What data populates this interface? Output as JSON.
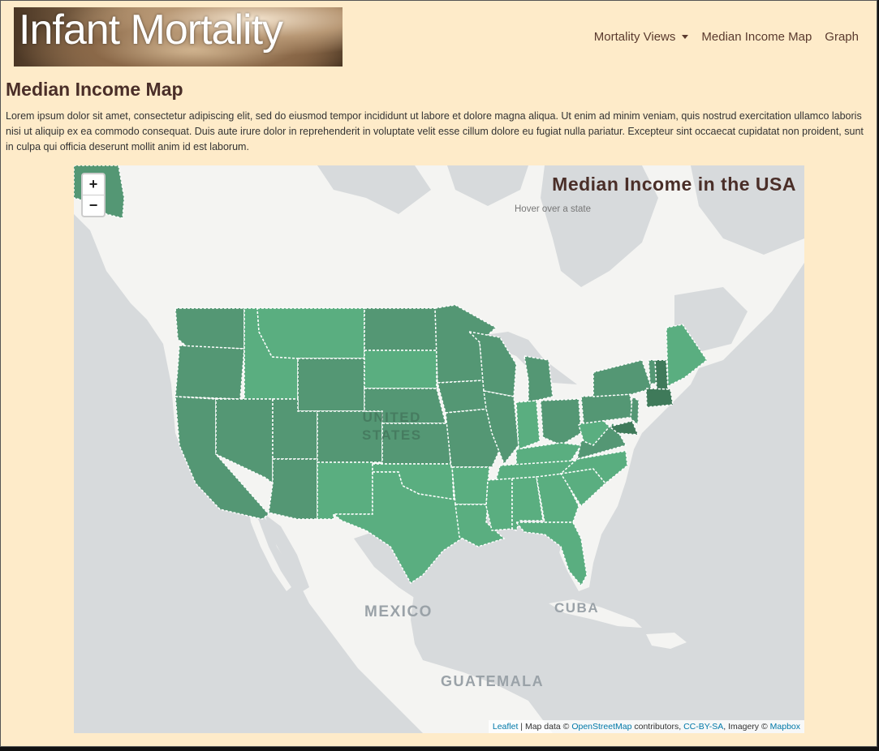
{
  "brand": {
    "title": "Infant Mortality"
  },
  "nav": {
    "items": [
      {
        "label": "Mortality Views",
        "dropdown": true
      },
      {
        "label": "Median Income Map",
        "dropdown": false
      },
      {
        "label": "Graph",
        "dropdown": false
      }
    ]
  },
  "page": {
    "heading": "Median Income Map",
    "body": "Lorem ipsum dolor sit amet, consectetur adipiscing elit, sed do eiusmod tempor incididunt ut labore et dolore magna aliqua. Ut enim ad minim veniam, quis nostrud exercitation ullamco laboris nisi ut aliquip ex ea commodo consequat. Duis aute irure dolor in reprehenderit in voluptate velit esse cillum dolore eu fugiat nulla pariatur. Excepteur sint occaecat cupidatat non proident, sunt in culpa qui officia deserunt mollit anim id est laborum."
  },
  "map": {
    "zoom_in": "+",
    "zoom_out": "−",
    "info_title": "Median Income in the USA",
    "info_hint": "Hover over a state",
    "labels": {
      "us_line1": "UNITED",
      "us_line2": "STATES",
      "mexico": "MEXICO",
      "cuba": "CUBA",
      "guatemala": "GUATEMALA"
    },
    "attribution": {
      "leaflet": "Leaflet",
      "sep1": " | Map data © ",
      "osm": "OpenStreetMap",
      "contributors": " contributors, ",
      "license": "CC-BY-SA",
      "imagery": ", Imagery © ",
      "mapbox": "Mapbox"
    },
    "colors": {
      "water": "#d7dadc",
      "land": "#f4f4f2",
      "light_green": "#5aae80",
      "dark_green": "#549774",
      "darkest_green": "#3f7a5a",
      "border": "#ffffff"
    }
  }
}
